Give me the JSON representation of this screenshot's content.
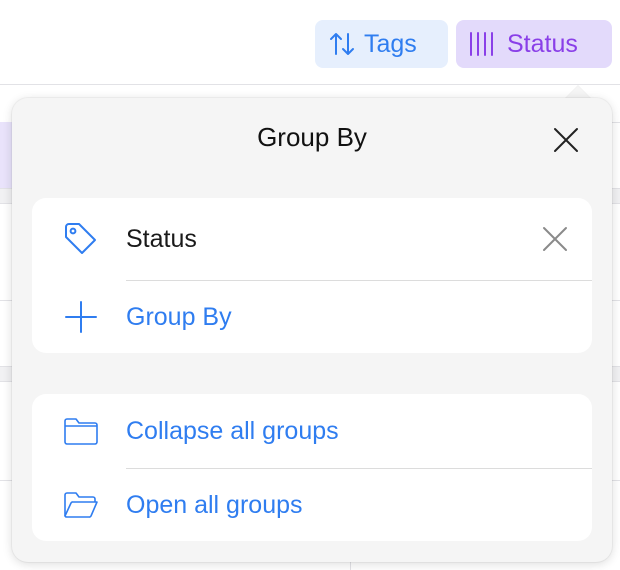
{
  "toolbar": {
    "tags_label": "Tags",
    "tags_icon": "sort-arrows-icon",
    "status_label": "Status",
    "status_icon": "columns-icon",
    "tags_color": "#2f7df0",
    "status_color": "#8a3fe8"
  },
  "popover": {
    "title": "Group By",
    "close_icon": "close-icon",
    "group_card": {
      "active_group": {
        "label": "Status",
        "icon": "tag-icon",
        "remove_icon": "close-icon"
      },
      "add_group": {
        "label": "Group By",
        "icon": "plus-icon"
      }
    },
    "actions_card": {
      "collapse_all": {
        "label": "Collapse all groups",
        "icon": "folder-icon"
      },
      "open_all": {
        "label": "Open all groups",
        "icon": "folder-open-icon"
      }
    }
  },
  "colors": {
    "accent_blue": "#2f7df0",
    "accent_purple": "#8a3fe8",
    "popover_bg": "#f5f5f5"
  }
}
